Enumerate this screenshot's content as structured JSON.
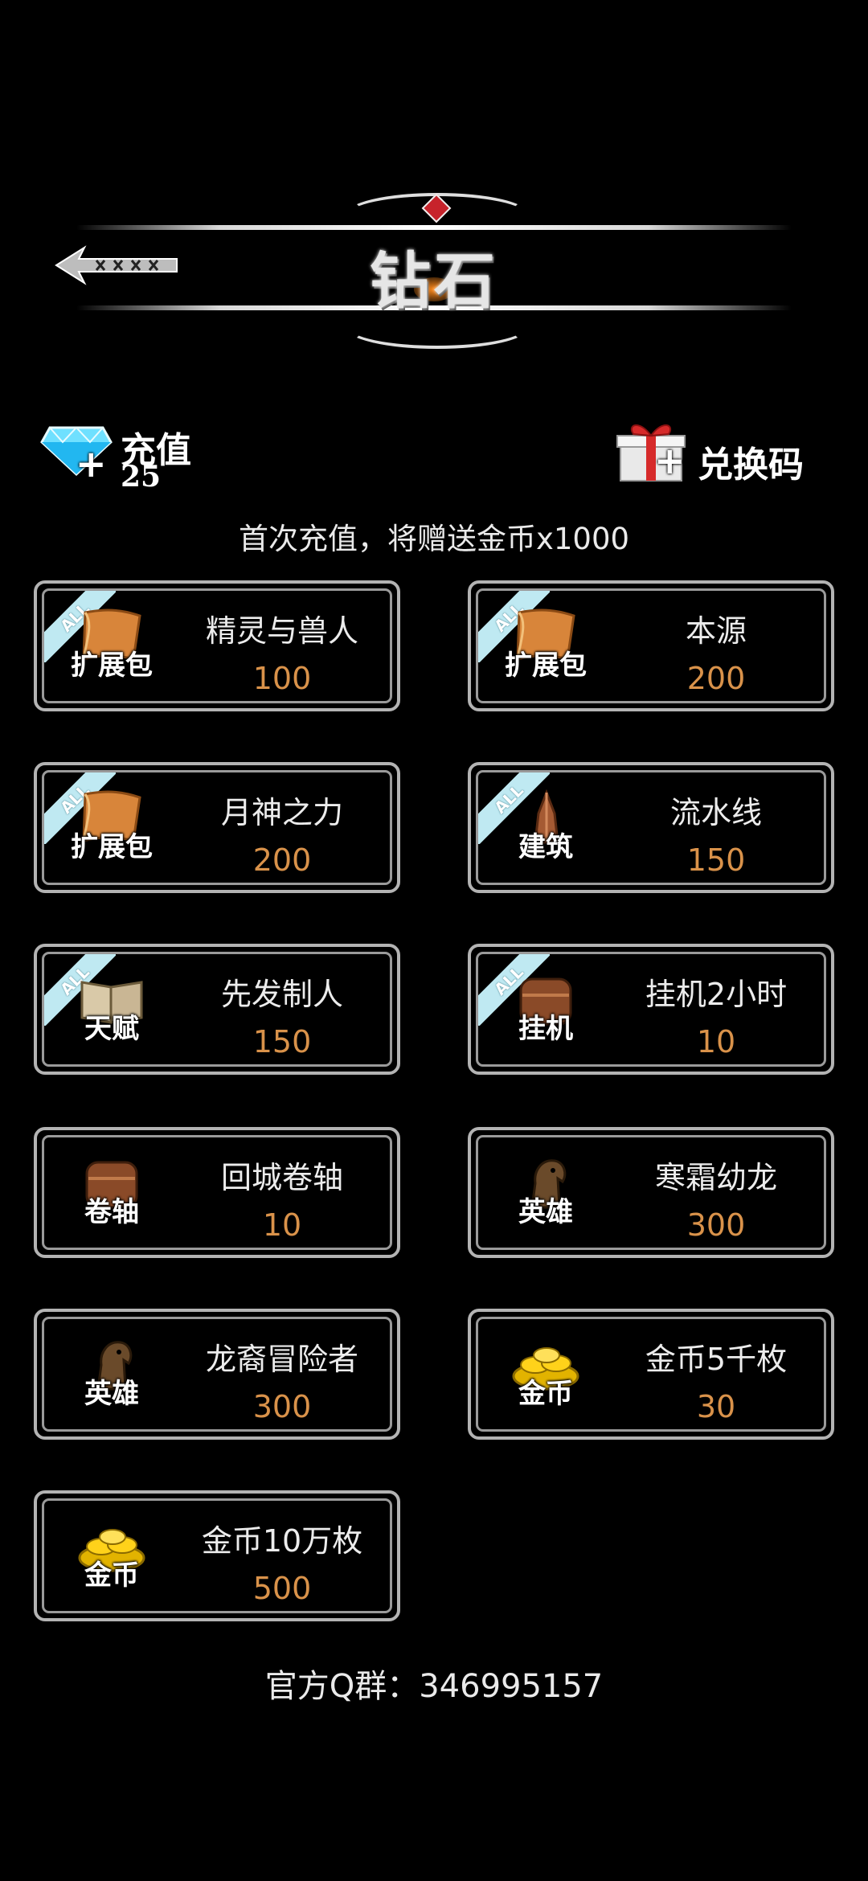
{
  "header": {
    "title": "钻石",
    "back_icon": "back-arrow-icon"
  },
  "recharge": {
    "label": "充值",
    "count": "25",
    "icon": "diamond-icon"
  },
  "redeem": {
    "label": "兑换码",
    "icon": "gift-icon"
  },
  "notice": "首次充值，将赠送金币x1000",
  "items": [
    {
      "badge": "ALL",
      "category": "扩展包",
      "name": "精灵与兽人",
      "price": "100",
      "icon": "scroll-icon"
    },
    {
      "badge": "ALL",
      "category": "扩展包",
      "name": "本源",
      "price": "200",
      "icon": "scroll-icon"
    },
    {
      "badge": "ALL",
      "category": "扩展包",
      "name": "月神之力",
      "price": "200",
      "icon": "scroll-icon"
    },
    {
      "badge": "ALL",
      "category": "建筑",
      "name": "流水线",
      "price": "150",
      "icon": "building-icon"
    },
    {
      "badge": "ALL",
      "category": "天赋",
      "name": "先发制人",
      "price": "150",
      "icon": "book-icon"
    },
    {
      "badge": "ALL",
      "category": "挂机",
      "name": "挂机2小时",
      "price": "10",
      "icon": "bag-icon"
    },
    {
      "badge": "",
      "category": "卷轴",
      "name": "回城卷轴",
      "price": "10",
      "icon": "bag-icon"
    },
    {
      "badge": "",
      "category": "英雄",
      "name": "寒霜幼龙",
      "price": "300",
      "icon": "horse-icon"
    },
    {
      "badge": "",
      "category": "英雄",
      "name": "龙裔冒险者",
      "price": "300",
      "icon": "horse-icon"
    },
    {
      "badge": "",
      "category": "金币",
      "name": "金币5千枚",
      "price": "30",
      "icon": "gold-coins-icon"
    },
    {
      "badge": "",
      "category": "金币",
      "name": "金币10万枚",
      "price": "500",
      "icon": "gold-coins-icon"
    }
  ],
  "footer": "官方Q群：346995157",
  "colors": {
    "background": "#000000",
    "price": "#d9924a",
    "border": "#b3b3b3",
    "badge": "#bfe9f2"
  }
}
